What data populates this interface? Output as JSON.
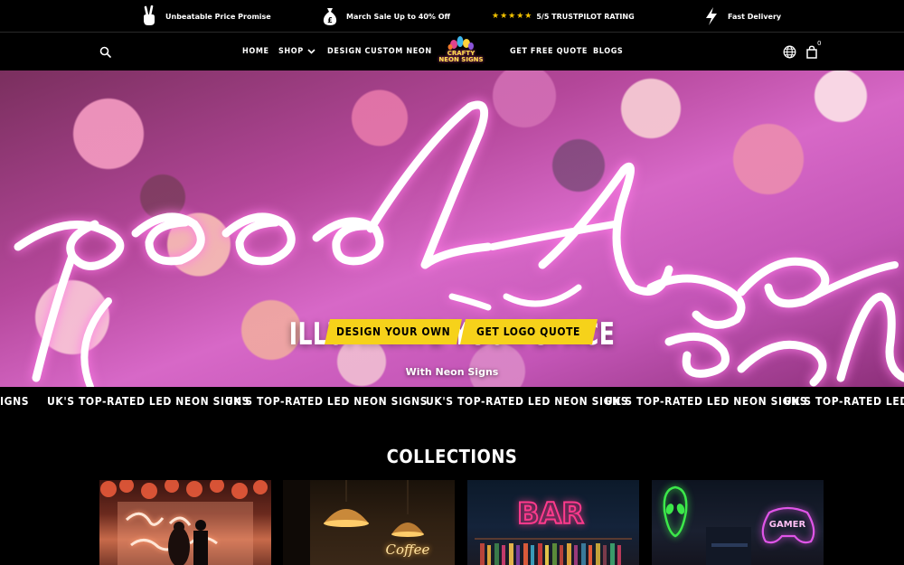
{
  "promo_bar": {
    "items": [
      {
        "icon": "peace-hand-icon",
        "text": "Unbeatable Price Promise"
      },
      {
        "icon": "money-bag-icon",
        "text": "March Sale Up to 40% Off"
      },
      {
        "icon": "star-rating-icon",
        "stars": "★★★★★",
        "text": "5/5 TRUSTPILOT RATING"
      },
      {
        "icon": "lightning-icon",
        "text": "Fast Delivery"
      }
    ]
  },
  "nav": {
    "links": [
      "HOME",
      "SHOP",
      "DESIGN CUSTOM NEON",
      "GET FREE QUOTE",
      "BLOGS"
    ],
    "logo_line1": "CRAFTY",
    "logo_line2": "NEON SIGNS",
    "cart_count": "0"
  },
  "hero": {
    "title": "ILLUMINATE YOUR SPACE",
    "subtitle": "With Neon Signs",
    "buttons": [
      "DESIGN YOUR OWN",
      "GET LOGO QUOTE"
    ],
    "accent_color": "#f6d21a"
  },
  "marquee": {
    "items": [
      "IGNS",
      "UK'S TOP-RATED LED NEON SIGNS",
      "UK'S TOP-RATED LED NEON SIGNS",
      "UK'S TOP-RATED LED NEON SIGNS",
      "UK'S TOP-RATED LED NEON SIGNS",
      "UK'S TOP-RATED LED NEON SIGNS"
    ]
  },
  "collections": {
    "title": "COLLECTIONS",
    "cards": [
      {
        "name": "happily-ever-after",
        "sign_text": "happily ever after"
      },
      {
        "name": "coffee",
        "sign_text": "Coffee"
      },
      {
        "name": "bar",
        "sign_text": "BAR"
      },
      {
        "name": "gamer",
        "sign_text": "GAMER"
      }
    ]
  }
}
